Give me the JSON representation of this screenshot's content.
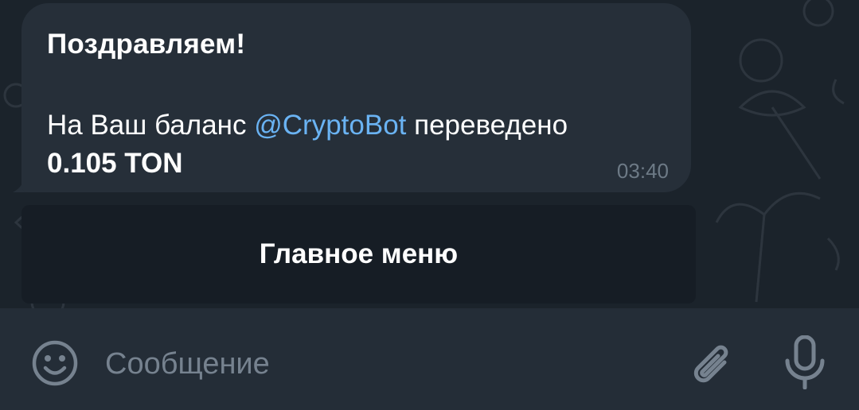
{
  "message": {
    "title": "Поздравляем!",
    "body_prefix": "На Ваш баланс ",
    "mention": "@CryptoBot",
    "body_suffix": " переведено ",
    "amount": "0.105 TON",
    "time": "03:40"
  },
  "keyboard": {
    "button_label": "Главное меню"
  },
  "composer": {
    "placeholder": "Сообщение",
    "value": ""
  },
  "icons": {
    "emoji": "smile-icon",
    "attach": "paperclip-icon",
    "voice": "microphone-icon"
  },
  "colors": {
    "background": "#1b232b",
    "bubble": "#262f39",
    "keyboard_button": "#161d25",
    "input_bar": "#242d37",
    "link": "#6ab3f3",
    "time": "#6d7a86",
    "icon": "#76828f"
  }
}
